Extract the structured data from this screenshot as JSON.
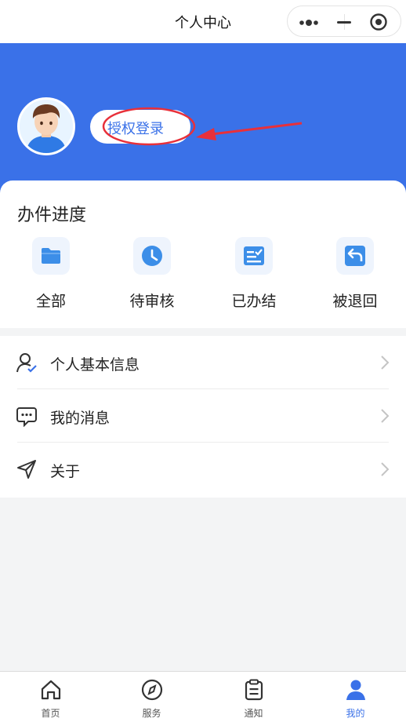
{
  "header": {
    "title": "个人中心"
  },
  "profile": {
    "login_label": "授权登录"
  },
  "progress": {
    "title": "办件进度",
    "items": [
      {
        "label": "全部",
        "icon": "folder-icon"
      },
      {
        "label": "待审核",
        "icon": "clock-icon"
      },
      {
        "label": "已办结",
        "icon": "checklist-icon"
      },
      {
        "label": "被退回",
        "icon": "return-icon"
      }
    ]
  },
  "menu": {
    "items": [
      {
        "label": "个人基本信息",
        "icon": "user-check-icon"
      },
      {
        "label": "我的消息",
        "icon": "message-icon"
      },
      {
        "label": "关于",
        "icon": "send-icon"
      }
    ]
  },
  "tabbar": {
    "items": [
      {
        "label": "首页",
        "icon": "home-icon"
      },
      {
        "label": "服务",
        "icon": "compass-icon"
      },
      {
        "label": "通知",
        "icon": "clipboard-icon"
      },
      {
        "label": "我的",
        "icon": "user-icon",
        "active": true
      }
    ]
  },
  "colors": {
    "primary": "#3a71e8",
    "annotation": "#e8303a",
    "background": "#f3f4f5"
  }
}
